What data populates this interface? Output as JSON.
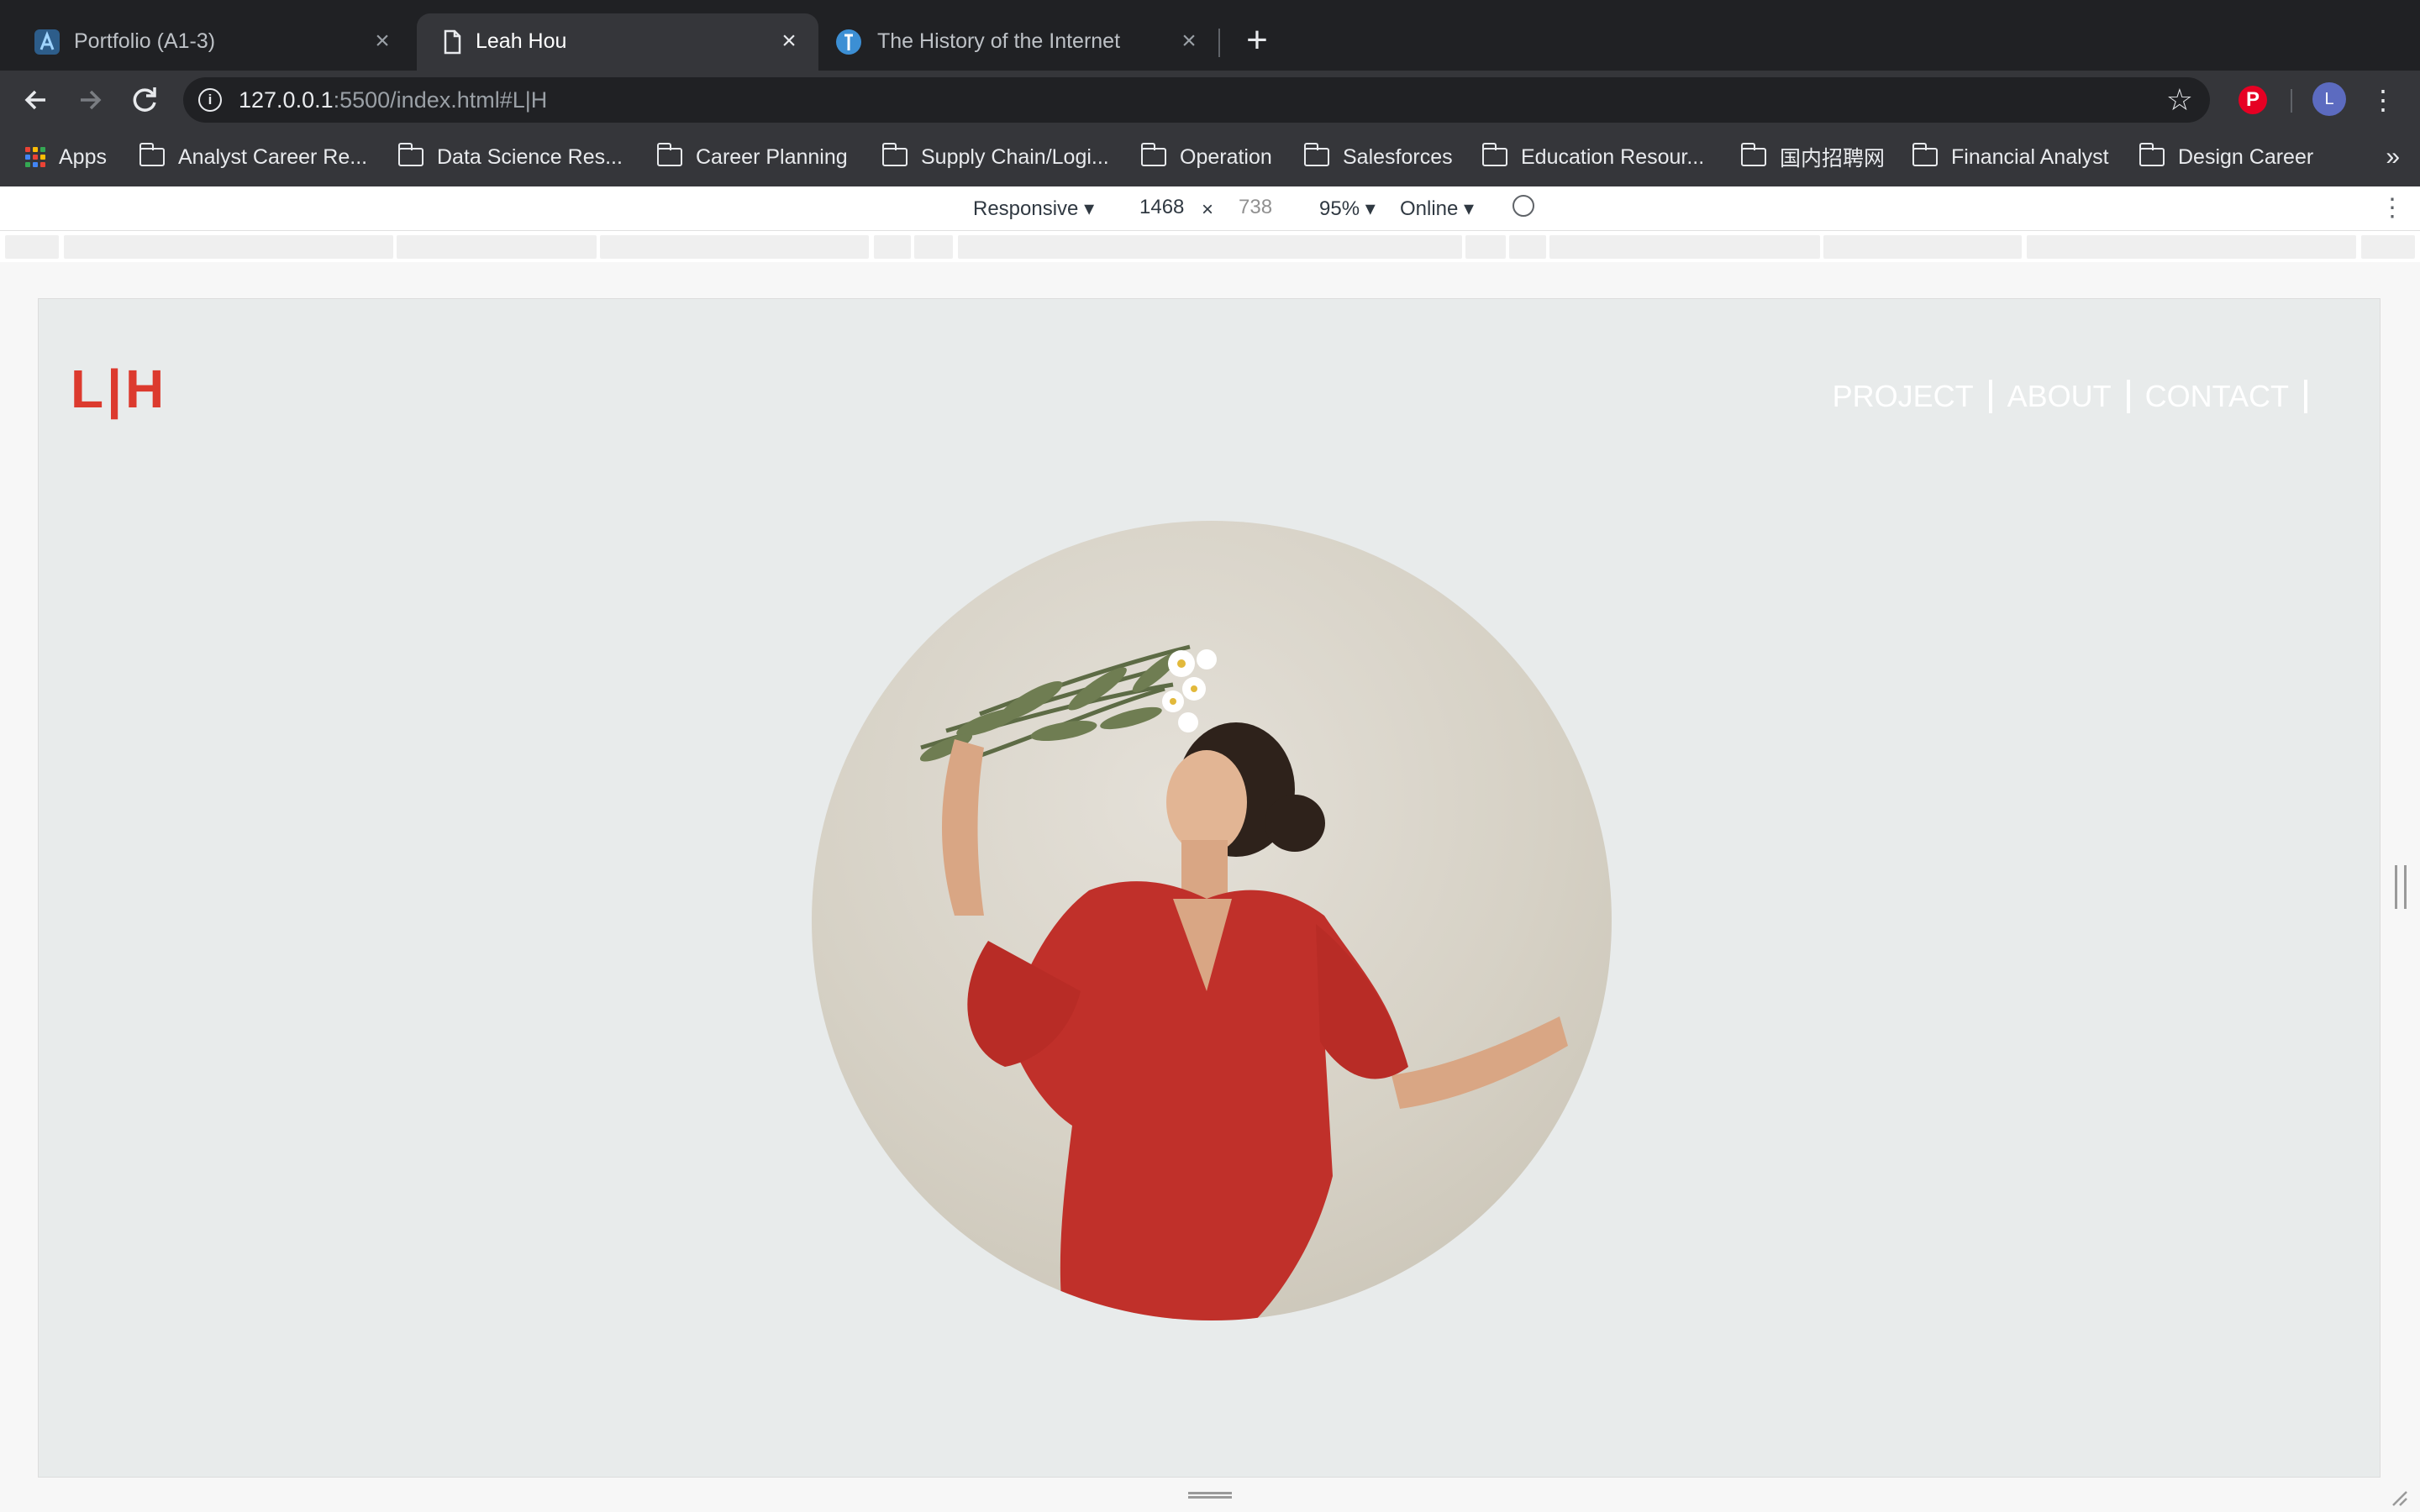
{
  "browser": {
    "tabs": [
      {
        "title": "Portfolio (A1-3)",
        "icon": "adobe-portfolio-icon",
        "active": false
      },
      {
        "title": "Leah Hou",
        "icon": "page-icon",
        "active": true
      },
      {
        "title": "The History of the Internet",
        "icon": "globe-icon",
        "active": false
      }
    ],
    "url_host": "127.0.0.1",
    "url_rest": ":5500/index.html#L|H",
    "bookmarks": [
      "Apps",
      "Analyst Career Re...",
      "Data Science Res...",
      "Career Planning",
      "Supply Chain/Logi...",
      "Operation",
      "Salesforces",
      "Education Resour...",
      "国内招聘网",
      "Financial Analyst",
      "Design Career"
    ],
    "more_bookmarks": "»",
    "avatar_letter": "L"
  },
  "devtools": {
    "device": "Responsive ▾",
    "width": "1468",
    "times": "×",
    "height": "738",
    "zoom": "95% ▾",
    "network": "Online ▾"
  },
  "site": {
    "logo": "L|H",
    "nav": [
      "PROJECT",
      "ABOUT",
      "CONTACT"
    ],
    "accent_color": "#dc3a2e",
    "background_color": "#e8ebeb"
  }
}
